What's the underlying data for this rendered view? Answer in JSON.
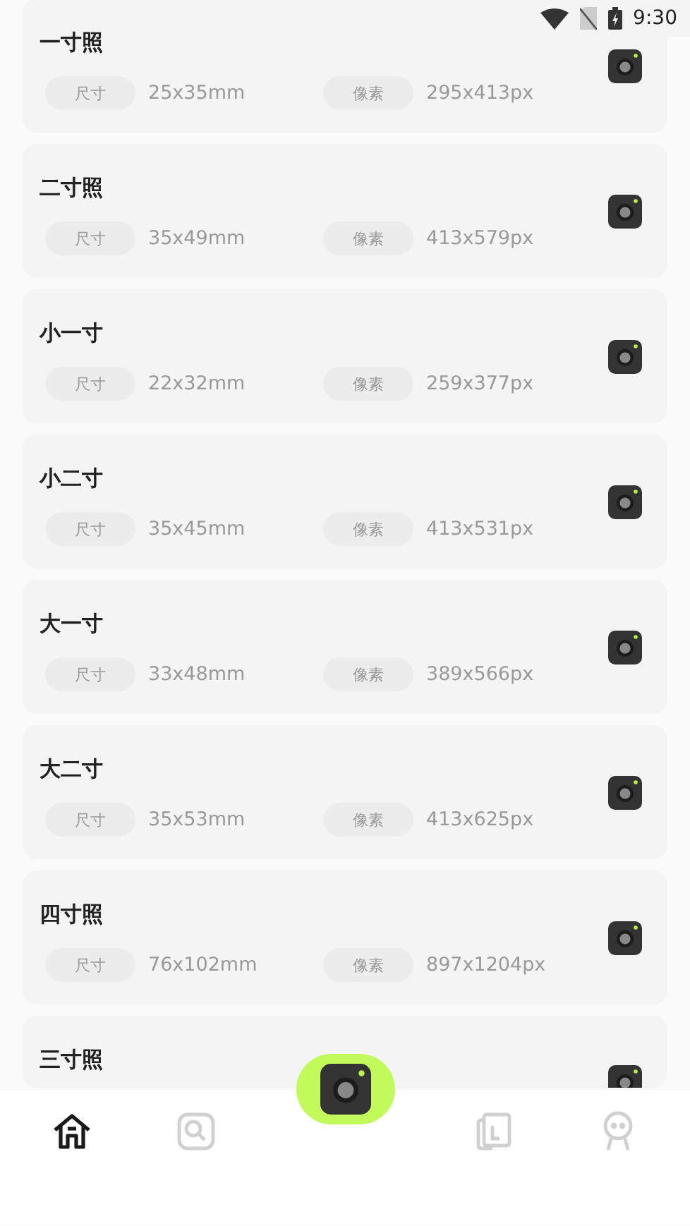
{
  "status_bar": {
    "time": "9:30"
  },
  "sizes": [
    {
      "title": "一寸照",
      "specs": [
        {
          "label": "尺寸",
          "value": "25x35mm"
        },
        {
          "label": "像素",
          "value": "295x413px"
        }
      ]
    },
    {
      "title": "二寸照",
      "specs": [
        {
          "label": "尺寸",
          "value": "35x49mm"
        },
        {
          "label": "像素",
          "value": "413x579px"
        }
      ]
    },
    {
      "title": "小一寸",
      "specs": [
        {
          "label": "尺寸",
          "value": "22x32mm"
        },
        {
          "label": "像素",
          "value": "259x377px"
        }
      ]
    },
    {
      "title": "小二寸",
      "specs": [
        {
          "label": "尺寸",
          "value": "35x45mm"
        },
        {
          "label": "像素",
          "value": "413x531px"
        }
      ]
    },
    {
      "title": "大一寸",
      "specs": [
        {
          "label": "尺寸",
          "value": "33x48mm"
        },
        {
          "label": "像素",
          "value": "389x566px"
        }
      ]
    },
    {
      "title": "大二寸",
      "specs": [
        {
          "label": "尺寸",
          "value": "35x53mm"
        },
        {
          "label": "像素",
          "value": "413x625px"
        }
      ]
    },
    {
      "title": "四寸照",
      "specs": [
        {
          "label": "尺寸",
          "value": "76x102mm"
        },
        {
          "label": "像素",
          "value": "897x1204px"
        }
      ]
    },
    {
      "title": "三寸照"
    }
  ],
  "bottom_nav": [
    {
      "kind": "home",
      "selected": true
    },
    {
      "kind": "tools",
      "selected": false
    },
    {
      "kind": "camera",
      "selected": false
    },
    {
      "kind": "album",
      "selected": false
    },
    {
      "kind": "profile",
      "selected": false
    }
  ]
}
